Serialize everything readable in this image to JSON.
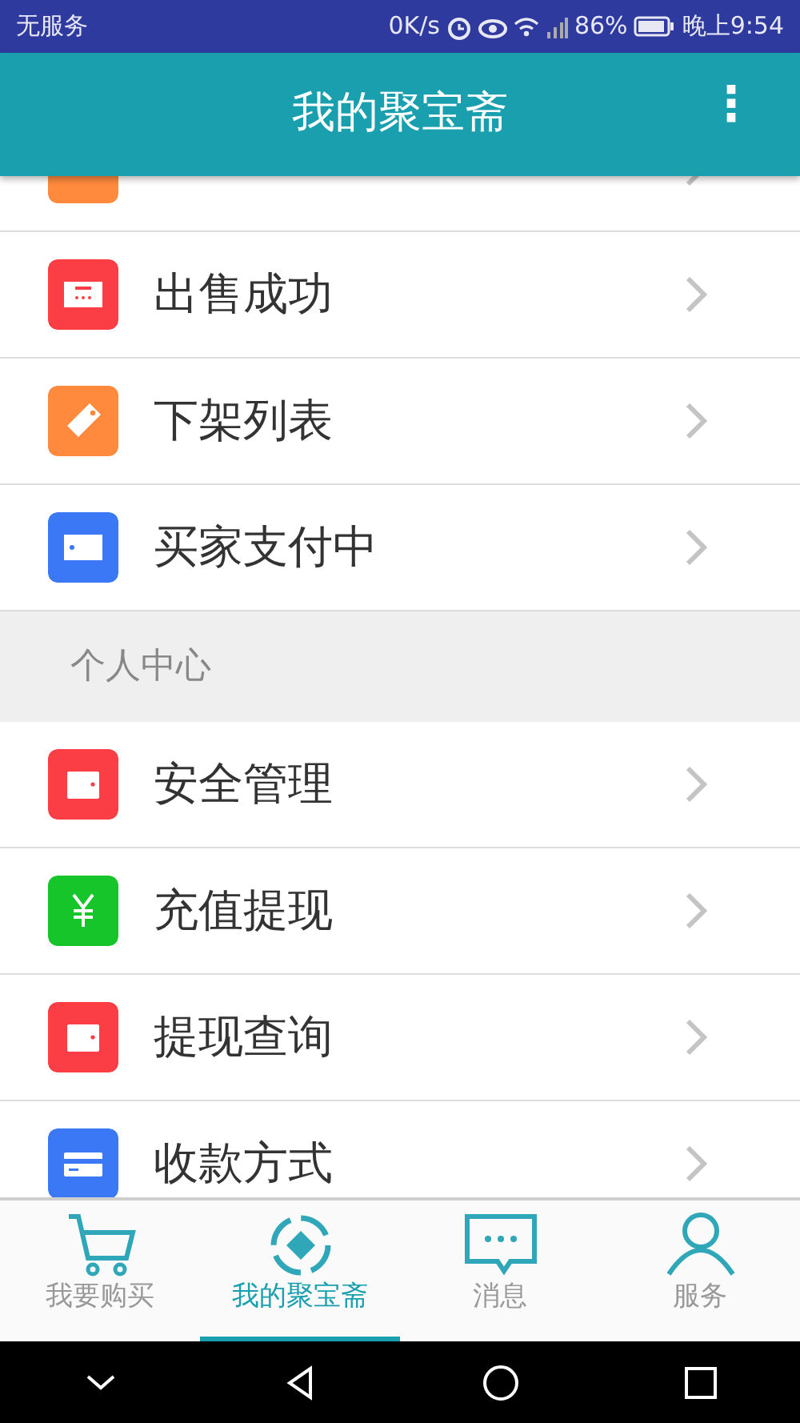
{
  "status_bar": {
    "carrier": "无服务",
    "speed": "0K/s",
    "battery": "86%",
    "time": "晚上9:54"
  },
  "app_bar": {
    "title": "我的聚宝斋",
    "menu": "⋮"
  },
  "list": [
    {
      "kind": "item",
      "color": "#ff8a3d"
    },
    {
      "kind": "item",
      "label": "出售成功",
      "color": "#fb3e45"
    },
    {
      "kind": "item",
      "label": "下架列表",
      "color": "#ff8a3d"
    },
    {
      "kind": "item",
      "label": "买家支付中",
      "color": "#3b78f6"
    },
    {
      "kind": "header",
      "label": "个人中心"
    },
    {
      "kind": "item",
      "label": "安全管理",
      "color": "#fb3e45"
    },
    {
      "kind": "item",
      "label": "充值提现",
      "color": "#16c52a"
    },
    {
      "kind": "item",
      "label": "提现查询",
      "color": "#fb3e45"
    },
    {
      "kind": "item",
      "label": "收款方式",
      "color": "#3b78f6"
    }
  ],
  "tabs": [
    {
      "label": "我要购买",
      "selected": false
    },
    {
      "label": "我的聚宝斋",
      "selected": true
    },
    {
      "label": "消息",
      "selected": false
    },
    {
      "label": "服务",
      "selected": false
    }
  ]
}
